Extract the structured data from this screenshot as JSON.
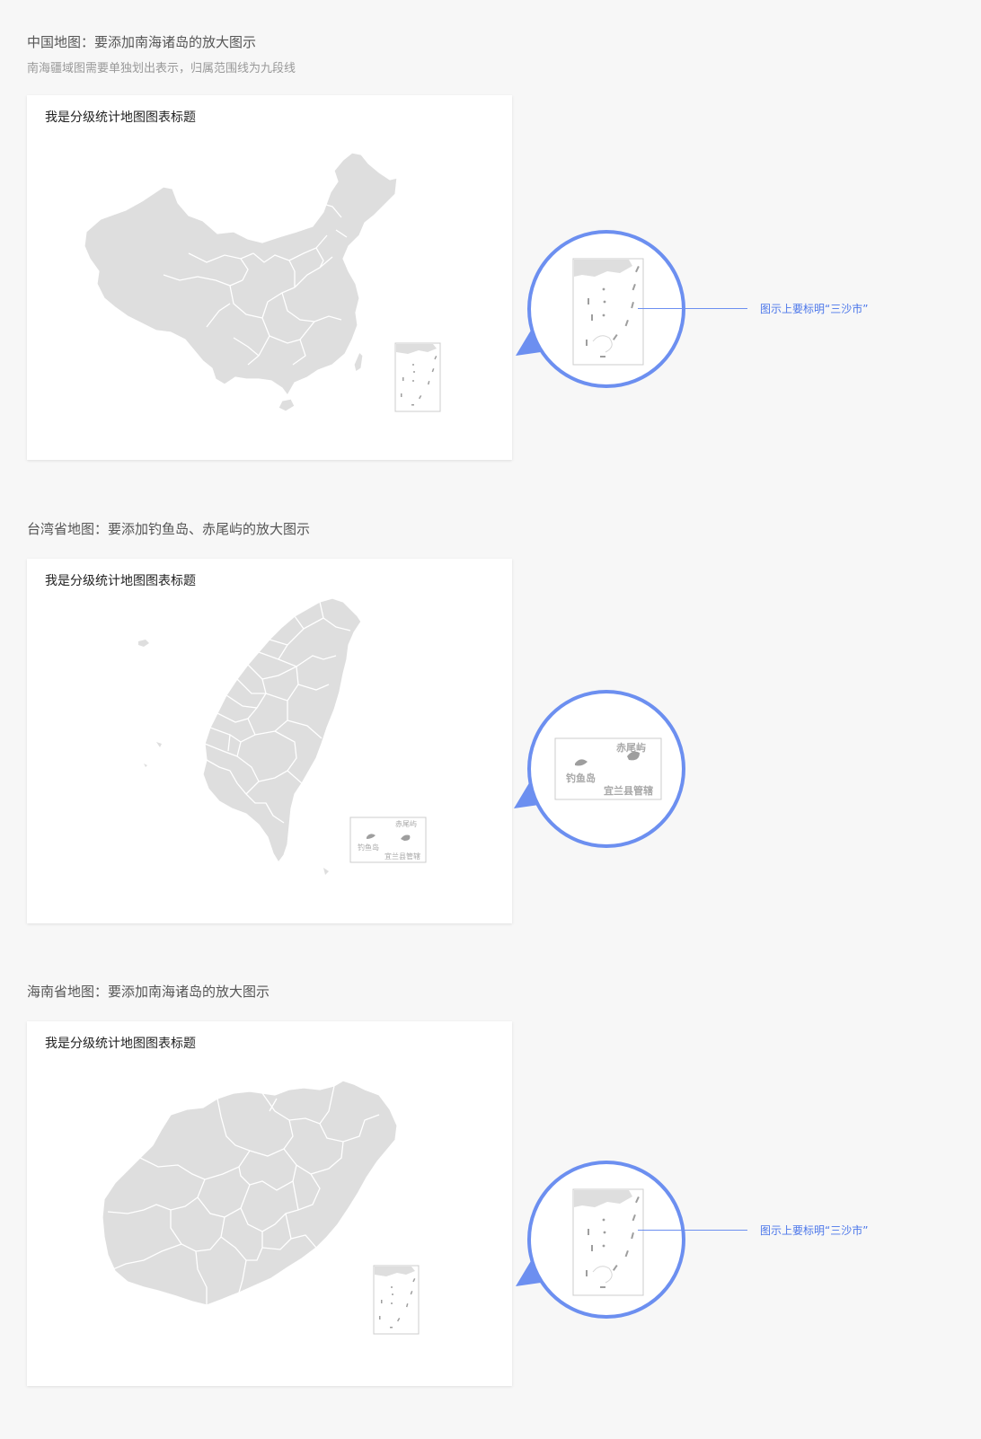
{
  "sections": [
    {
      "title": "中国地图：要添加南海诸岛的放大图示",
      "subtitle": "南海疆域图需要单独划出表示，归属范围线为九段线",
      "card_title": "我是分级统计地图图表标题",
      "callout_note": "图示上要标明“三沙市”"
    },
    {
      "title": "台湾省地图：要添加钓鱼岛、赤尾屿的放大图示",
      "card_title": "我是分级统计地图图表标题",
      "inset_labels": {
        "chiweiyu": "赤尾屿",
        "diaoyudao": "钓鱼岛",
        "yilan": "宜兰县管辖"
      }
    },
    {
      "title": "海南省地图：要添加南海诸岛的放大图示",
      "card_title": "我是分级统计地图图表标题",
      "callout_note": "图示上要标明“三沙市”"
    }
  ],
  "colors": {
    "page_bg": "#f7f7f7",
    "card_bg": "#ffffff",
    "map_fill": "#dedede",
    "accent": "#6c8ff0",
    "annotation_text": "#4c77ea"
  },
  "icons": {
    "callout": "magnifier-callout-circle"
  }
}
